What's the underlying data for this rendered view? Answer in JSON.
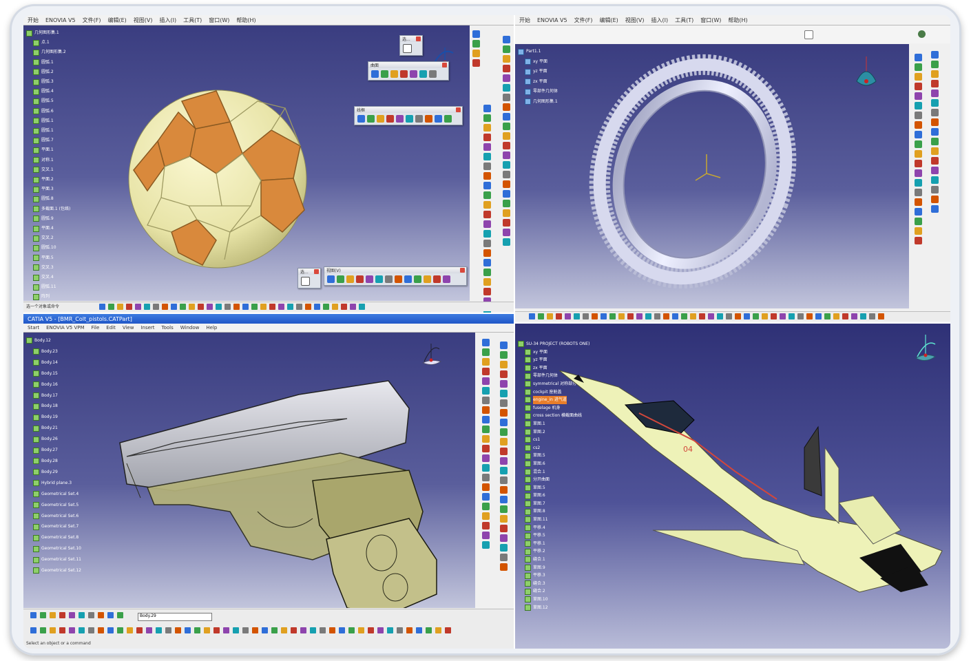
{
  "quadrants": {
    "q1": {
      "menu": [
        "开始",
        "ENOVIA V5",
        "文件(F)",
        "编辑(E)",
        "视图(V)",
        "插入(I)",
        "工具(T)",
        "窗口(W)",
        "帮助(H)"
      ],
      "tree": [
        "几何图形集.1",
        "点.1",
        "几何图形集.2",
        "圆弧.1",
        "圆弧.2",
        "圆弧.3",
        "圆弧.4",
        "圆弧.5",
        "圆弧.6",
        "圆弧.1",
        "圆弧.1",
        "圆弧.7",
        "平面.1",
        "对称.1",
        "交叉.1",
        "平面.2",
        "平面.3",
        "圆弧.8",
        "多截面.1 (包络)",
        "圆弧.9",
        "平面.4",
        "交叉.2",
        "圆弧.10",
        "平面.5",
        "交叉.3",
        "交叉.4",
        "圆弧.11",
        "阵列"
      ],
      "toolbars": [
        {
          "title": "曲面"
        },
        {
          "title": "线框"
        },
        {
          "title": "视图(V)"
        },
        {
          "title": "选..."
        }
      ],
      "status": "选一个对象或命令",
      "ball_colors": {
        "panel": "#f0edb4",
        "patch": "#d9893c"
      }
    },
    "q2": {
      "menu": [
        "开始",
        "ENOVIA V5",
        "文件(F)",
        "编辑(E)",
        "视图(V)",
        "插入(I)",
        "工具(T)",
        "窗口(W)",
        "帮助(H)"
      ],
      "tree": [
        "Part1.1",
        "xy 平面",
        "yz 平面",
        "zx 平面",
        "零部件几何体",
        "几何图形集.1"
      ]
    },
    "q3": {
      "title": "CATIA V5 - [BMR_Colt_pistols.CATPart]",
      "menu": [
        "Start",
        "ENOVIA V5 VPM",
        "File",
        "Edit",
        "View",
        "Insert",
        "Tools",
        "Window",
        "Help"
      ],
      "tree": [
        "Body.12",
        "Body.23",
        "Body.14",
        "Body.15",
        "Body.16",
        "Body.17",
        "Body.18",
        "Body.19",
        "Body.21",
        "Body.26",
        "Body.27",
        "Body.28",
        "Body.29",
        "Hybrid plane.3",
        "Geometrical Set.4",
        "Geometrical Set.5",
        "Geometrical Set.6",
        "Geometrical Set.7",
        "Geometrical Set.8",
        "Geometrical Set.10",
        "Geometrical Set.11",
        "Geometrical Set.12"
      ],
      "dropdown_value": "Body.29",
      "status": "Select an object or a command"
    },
    "q4": {
      "tree": [
        "SU-34 PROJECT (ROBOTS ONE)",
        "xy 平面",
        "yz 平面",
        "zx 平面",
        "零部件几何体",
        "symmetrical 对称部分",
        "cockpit 座舱盖",
        "engine_in 进气道",
        "fuselage 机身",
        "cross section 横截面曲线",
        "草图.1",
        "草图.2",
        "cs1",
        "cs2",
        "草图.5",
        "草图.6",
        "混合.1",
        "分开曲面",
        "草图.5",
        "草图.6",
        "草图.7",
        "草图.8",
        "草图.11",
        "平移.4",
        "平移.5",
        "平移.1",
        "平移.2",
        "缝合.1",
        "草图.9",
        "平移.3",
        "缝合.3",
        "缝合.2",
        "草图.10",
        "草图.12"
      ],
      "highlight_index": 7,
      "jet_marking": "04",
      "jet_colors": {
        "body": "#eef2b8",
        "stripe": "#d2473b"
      }
    }
  }
}
